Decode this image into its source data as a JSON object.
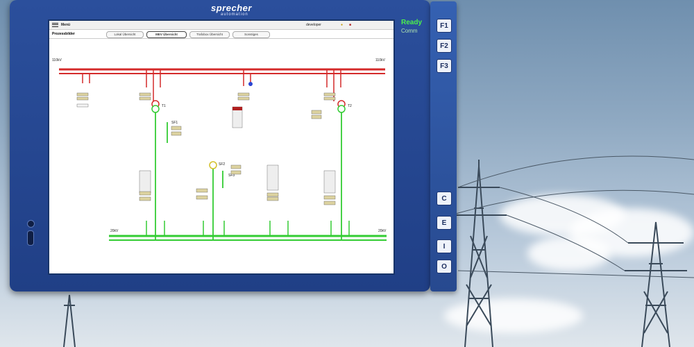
{
  "device": {
    "brand": "sprecher",
    "brand_sub": "automation",
    "status_ready": "Ready",
    "status_sub": "Comm",
    "function_keys": [
      "F1",
      "F2",
      "F3"
    ],
    "side_keys": [
      "C",
      "E",
      "I",
      "O"
    ]
  },
  "screen": {
    "menu_label": "Menü",
    "page_title": "Prozessbilder",
    "user": "developer",
    "tabs": [
      {
        "label": "Lokal Übersicht",
        "active": false
      },
      {
        "label": "MEV Übersicht",
        "active": true
      },
      {
        "label": "Trafobox Übersicht",
        "active": false
      },
      {
        "label": "Sonstiges",
        "active": false
      }
    ],
    "diagram": {
      "bus_top_left": "110kV",
      "bus_top_right": "110kV",
      "bus_bottom_left": "20kV",
      "bus_bottom_right": "20kV",
      "transformer_labels": [
        "T1",
        "T2"
      ],
      "feeder_labels": [
        "SF1",
        "SF2",
        "SF3"
      ]
    }
  },
  "colors": {
    "bus_red": "#d42a2a",
    "bus_green": "#33cc33",
    "device_blue": "#244696"
  }
}
